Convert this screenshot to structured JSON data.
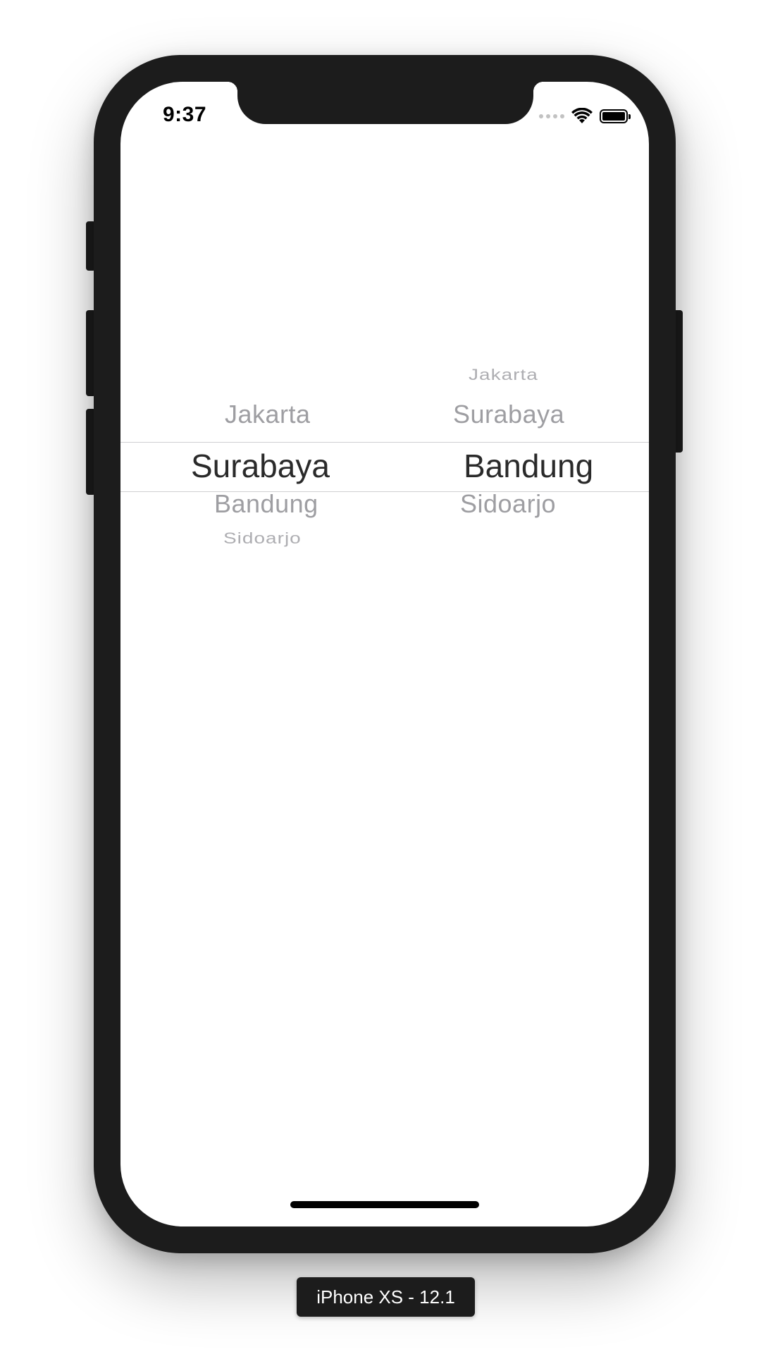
{
  "status_bar": {
    "time": "9:37",
    "icons": [
      "cellular-signal-icon",
      "wifi-icon",
      "battery-icon"
    ]
  },
  "picker": {
    "columns": [
      {
        "items": [
          "Jakarta",
          "Surabaya",
          "Bandung",
          "Sidoarjo"
        ],
        "selected": "Surabaya",
        "visible": {
          "above_near": "Jakarta",
          "selected": "Surabaya",
          "below_near": "Bandung",
          "below_far": "Sidoarjo"
        }
      },
      {
        "items": [
          "Jakarta",
          "Surabaya",
          "Bandung",
          "Sidoarjo"
        ],
        "selected": "Bandung",
        "visible": {
          "above_far": "Jakarta",
          "above_near": "Surabaya",
          "selected": "Bandung",
          "below_near": "Sidoarjo"
        }
      }
    ]
  },
  "simulator": {
    "device_label": "iPhone XS - 12.1"
  },
  "colors": {
    "frame": "#1c1c1c",
    "screen": "#ffffff",
    "selected_text": "#2a2a2a",
    "dim_text": "#9e9ea2",
    "separator": "#cfcfd2"
  }
}
